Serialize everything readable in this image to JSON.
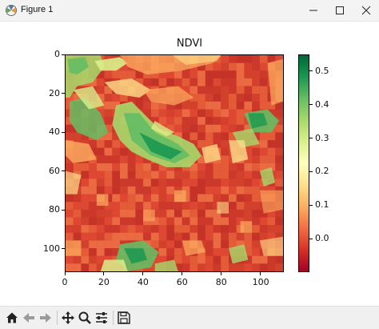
{
  "window": {
    "title": "Figure 1",
    "icons": [
      "matplotlib-logo-icon",
      "minimize-icon",
      "maximize-icon",
      "close-icon"
    ]
  },
  "toolbar": {
    "buttons": [
      "home-icon",
      "back-arrow-icon",
      "forward-arrow-icon",
      "pan-move-icon",
      "zoom-magnifier-icon",
      "configure-subplots-icon",
      "save-floppy-icon"
    ]
  },
  "colors": {
    "colormap": "RdYlGn",
    "low": "#a50026",
    "mid": "#ffffbf",
    "high": "#006837"
  },
  "chart_data": {
    "type": "heatmap",
    "title": "NDVI",
    "xlabel": "",
    "ylabel": "",
    "x_ticks": [
      "0",
      "20",
      "40",
      "60",
      "80",
      "100"
    ],
    "y_ticks": [
      "0",
      "20",
      "40",
      "60",
      "80",
      "100"
    ],
    "xlim": [
      0,
      112
    ],
    "ylim": [
      112,
      0
    ],
    "grid": false,
    "colorbar": {
      "ticks": [
        "0.5",
        "0.4",
        "0.3",
        "0.2",
        "0.1",
        "0.0"
      ],
      "range": [
        -0.1,
        0.55
      ],
      "colormap": "RdYlGn"
    }
  }
}
